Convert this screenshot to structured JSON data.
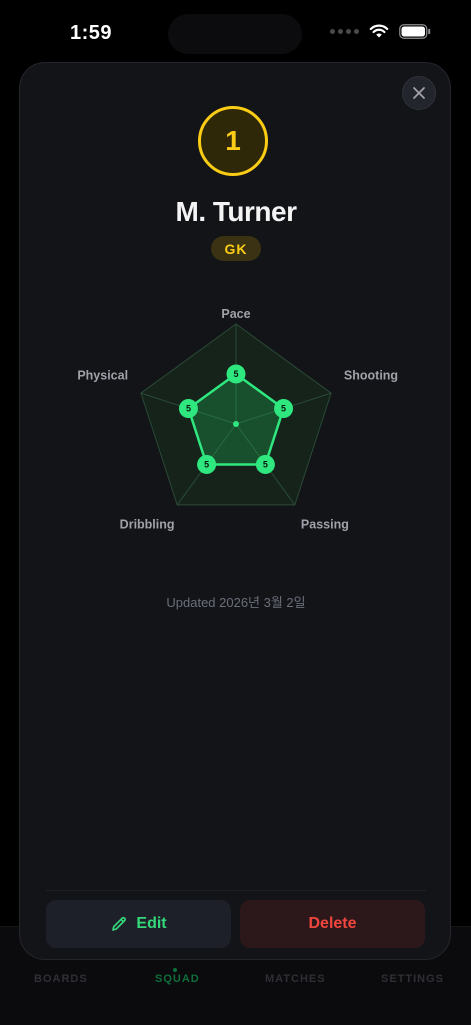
{
  "status_bar": {
    "time": "1:59"
  },
  "tab_bar": {
    "tabs": [
      {
        "label": "BOARDS",
        "active": false
      },
      {
        "label": "SQUAD",
        "active": true
      },
      {
        "label": "MATCHES",
        "active": false
      },
      {
        "label": "SETTINGS",
        "active": false
      }
    ]
  },
  "player": {
    "number": "1",
    "name": "M. Turner",
    "position": "GK"
  },
  "chart_data": {
    "type": "radar",
    "axes": [
      "Pace",
      "Shooting",
      "Passing",
      "Dribbling",
      "Physical"
    ],
    "values": [
      5,
      5,
      5,
      5,
      5
    ],
    "value_labels": [
      "5",
      "5",
      "5",
      "5",
      "5"
    ],
    "range": [
      0,
      10
    ],
    "rings": 2,
    "colors": {
      "fill": "#22c55e",
      "stroke": "#2ee87f",
      "grid": "#2a4a36"
    }
  },
  "updated_text": "Updated 2026년 3월 2일",
  "actions": {
    "edit_label": "Edit",
    "delete_label": "Delete"
  },
  "colors": {
    "accent_green": "#34d77a",
    "accent_yellow": "#facc15",
    "danger": "#f0463d"
  }
}
